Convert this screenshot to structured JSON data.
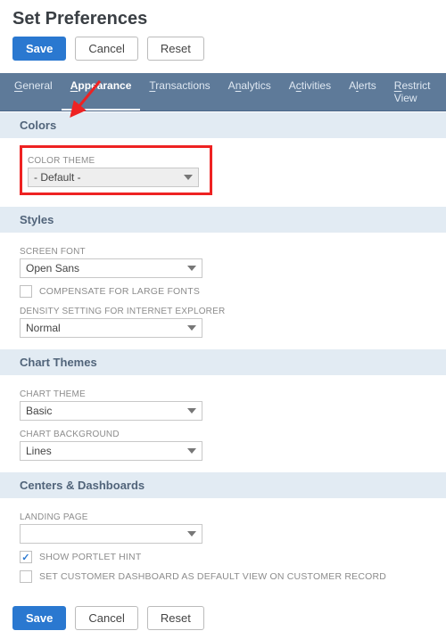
{
  "title": "Set Preferences",
  "buttons": {
    "save": "Save",
    "cancel": "Cancel",
    "reset": "Reset"
  },
  "tabs": {
    "general": "General",
    "appearance": "Appearance",
    "transactions": "Transactions",
    "analytics": "Analytics",
    "activities": "Activities",
    "alerts": "Alerts",
    "restrict": "Restrict View"
  },
  "sections": {
    "colors": {
      "title": "Colors",
      "color_theme_label": "COLOR THEME",
      "color_theme_value": "- Default -"
    },
    "styles": {
      "title": "Styles",
      "screen_font_label": "SCREEN FONT",
      "screen_font_value": "Open Sans",
      "compensate_large_label": "COMPENSATE FOR LARGE FONTS",
      "density_label": "DENSITY SETTING FOR INTERNET EXPLORER",
      "density_value": "Normal"
    },
    "chart_themes": {
      "title": "Chart Themes",
      "chart_theme_label": "CHART THEME",
      "chart_theme_value": "Basic",
      "chart_bg_label": "CHART BACKGROUND",
      "chart_bg_value": "Lines"
    },
    "centers": {
      "title": "Centers & Dashboards",
      "landing_label": "LANDING PAGE",
      "landing_value": "",
      "show_portlet_hint": "SHOW PORTLET HINT",
      "set_customer_dashboard": "SET CUSTOMER DASHBOARD AS DEFAULT VIEW ON CUSTOMER RECORD"
    }
  }
}
